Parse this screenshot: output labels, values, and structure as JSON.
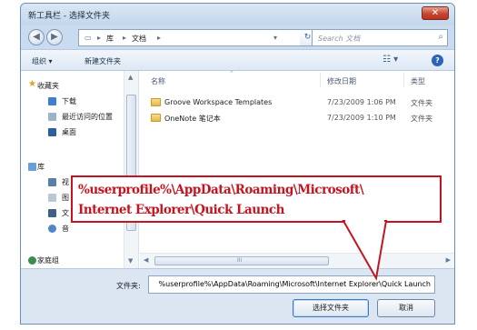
{
  "window": {
    "title": "新工具栏 - 选择文件夹",
    "close_glyph": "✕"
  },
  "address": {
    "back_glyph": "◀",
    "forward_glyph": "▶",
    "path": [
      "库",
      "文档"
    ],
    "separator": "▸",
    "dropdown_glyph": "▾",
    "refresh_glyph": "↻",
    "search_placeholder": "Search 文档"
  },
  "toolbar": {
    "organize": "组织 ▾",
    "new_folder": "新建文件夹",
    "view_glyph": "☷ ▾",
    "help_glyph": "?"
  },
  "nav": {
    "favorites": {
      "label": "收藏夹",
      "items": [
        "下载",
        "最近访问的位置",
        "桌面"
      ]
    },
    "libraries": {
      "label": "库",
      "items": [
        "视",
        "图",
        "文",
        "音"
      ]
    },
    "homegroup": "家庭组"
  },
  "list": {
    "columns": [
      "名称",
      "修改日期",
      "类型"
    ],
    "rows": [
      {
        "name": "Groove Workspace Templates",
        "date": "7/23/2009 1:06 PM",
        "type": "文件夹"
      },
      {
        "name": "OneNote 笔记本",
        "date": "7/23/2009 1:10 PM",
        "type": "文件夹"
      }
    ],
    "hscroll_grip": "III"
  },
  "footer": {
    "filename_label": "文件夹:",
    "filename_value": "%userprofile%\\AppData\\Roaming\\Microsoft\\Internet Explorer\\Quick Launch",
    "select_button": "选择文件夹",
    "cancel_button": "取消"
  },
  "callout": {
    "line1": "%userprofile%\\AppData\\Roaming\\Microsoft\\",
    "line2": "Internet Explorer\\Quick Launch",
    "color": "#c4141f"
  }
}
